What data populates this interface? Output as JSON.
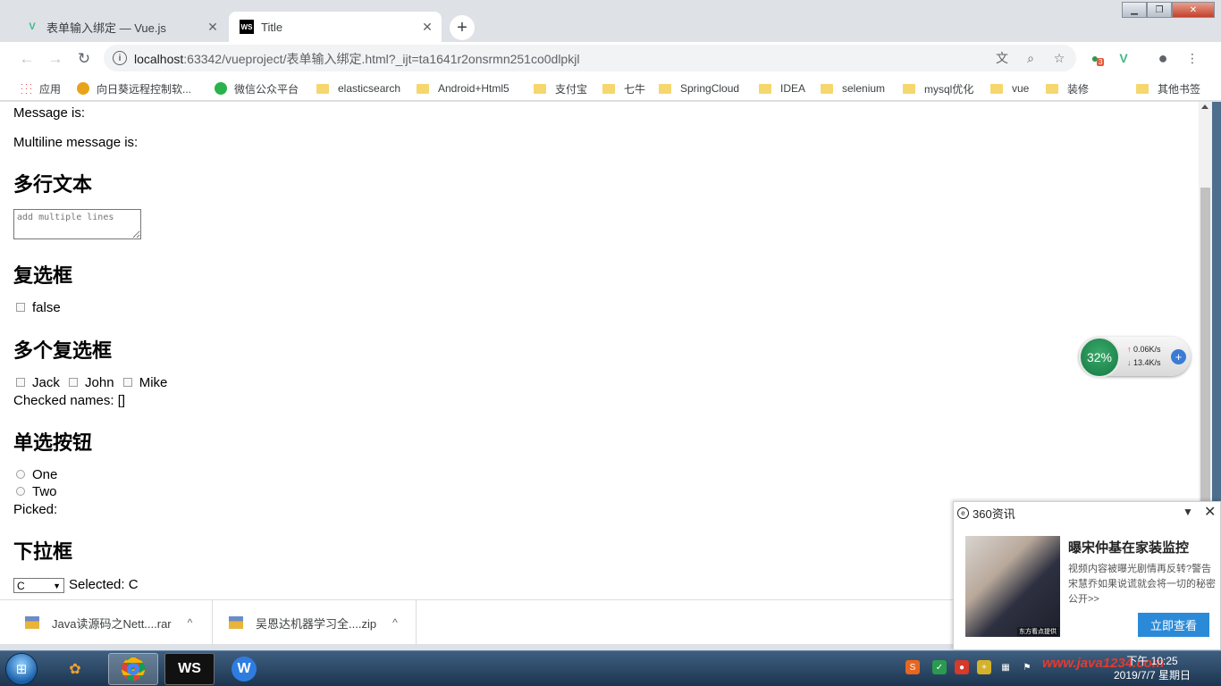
{
  "browser": {
    "tabs": [
      {
        "label": "表单输入绑定 — Vue.js",
        "active": false
      },
      {
        "label": "Title",
        "active": true
      }
    ],
    "url_host": "localhost",
    "url_rest": ":63342/vueproject/表单输入绑定.html?_ijt=ta1641r2onsrmn251co0dlpkjl",
    "extension_badge": "3"
  },
  "bookmarks": [
    "应用",
    "向日葵远程控制软...",
    "微信公众平台",
    "elasticsearch",
    "Android+Html5",
    "支付宝",
    "七牛",
    "SpringCloud",
    "IDEA",
    "selenium",
    "mysql优化",
    "vue",
    "装修",
    "其他书签"
  ],
  "page": {
    "message_label": "Message is:",
    "multiline_label": "Multiline message is:",
    "h_textarea": "多行文本",
    "textarea_placeholder": "add multiple lines",
    "h_checkbox": "复选框",
    "checkbox_label": "false",
    "h_multi_checkbox": "多个复选框",
    "names": [
      "Jack",
      "John",
      "Mike"
    ],
    "checked_names": "Checked names: []",
    "h_radio": "单选按钮",
    "radios": [
      "One",
      "Two"
    ],
    "picked": "Picked:",
    "h_select": "下拉框",
    "select_value": "C",
    "selected_text": "Selected: C"
  },
  "speed_widget": {
    "percent": "32%",
    "up": "0.06K/s",
    "down": "13.4K/s"
  },
  "news_popup": {
    "source": "360资讯",
    "title": "曝宋仲基在家装监控",
    "body": "视频内容被曝光剧情再反转?警告宋慧乔如果说谎就会将一切的秘密公开>>",
    "image_caption": "东方看点提供",
    "button": "立即查看"
  },
  "downloads": [
    "Java读源码之Nett....rar",
    "吴恩达机器学习全....zip"
  ],
  "taskbar": {
    "time": "下午 10:25",
    "date": "2019/7/7 星期日",
    "watermark": "www.java1234.com"
  },
  "colors": {
    "accent": "#2b8ad8",
    "widget_green": "#127a43"
  }
}
